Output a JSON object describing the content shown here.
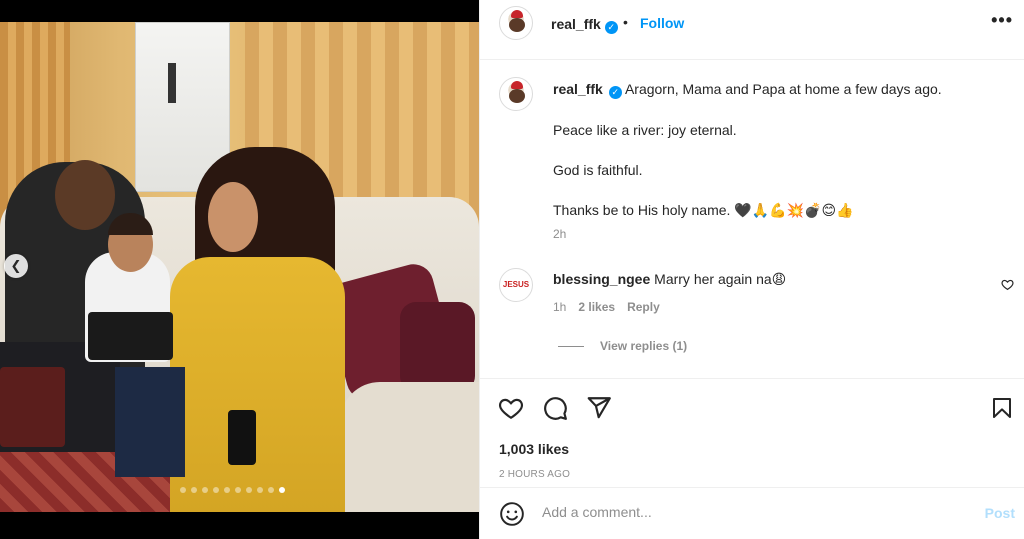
{
  "post": {
    "photo_alt": "",
    "carousel": {
      "count": 10,
      "active_index": 9
    }
  },
  "header": {
    "username": "real_ffk",
    "separator": "•",
    "follow_label": "Follow",
    "more_label": "•••"
  },
  "caption": {
    "username": "real_ffk",
    "lines": [
      "Aragorn, Mama and Papa at home a few days ago.",
      "Peace like a river: joy eternal.",
      "God is faithful.",
      "Thanks be to His holy name. 🖤🙏💪💥💣😊👍"
    ],
    "time": "2h"
  },
  "comment": {
    "avatar_text": "JESUS",
    "username": "blessing_ngee",
    "text": "Marry her again na😩",
    "time": "1h",
    "likes": "2 likes",
    "reply_label": "Reply",
    "view_replies": "View replies (1)"
  },
  "stats": {
    "likes": "1,003 likes",
    "posted": "2 HOURS AGO"
  },
  "composer": {
    "placeholder": "Add a comment...",
    "post_label": "Post"
  },
  "colors": {
    "accent": "#0095f6",
    "post_disabled": "#b2dffc",
    "muted": "#8e8e8e",
    "text": "#262626"
  },
  "icons": [
    "verified-icon",
    "more-icon",
    "heart-icon",
    "comment-icon",
    "share-icon",
    "save-icon",
    "emoji-icon",
    "chevron-left-icon"
  ]
}
